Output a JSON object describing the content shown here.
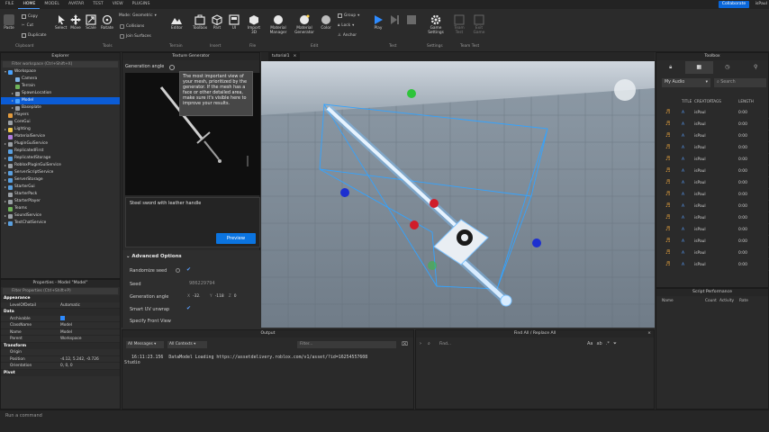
{
  "menubar": {
    "items": [
      "FILE",
      "HOME",
      "MODEL",
      "AVATAR",
      "TEST",
      "VIEW",
      "PLUGINS"
    ],
    "active": "HOME",
    "collaborate": "Collaborate",
    "user": "isPaul"
  },
  "ribbon": {
    "clipboard": {
      "paste": "Paste",
      "copy": "Copy",
      "cut": "Cut",
      "duplicate": "Duplicate",
      "group": "Clipboard"
    },
    "tools": {
      "select": "Select",
      "move": "Move",
      "scale": "Scale",
      "rotate": "Rotate",
      "group": "Tools",
      "mode_label": "Mode:",
      "mode_value": "Geometric",
      "collisions": "Collisions",
      "join_surfaces": "Join Surfaces"
    },
    "terrain": {
      "editor": "Editor",
      "group": "Terrain"
    },
    "insert": {
      "toolbox": "Toolbox",
      "part": "Part",
      "ui": "UI",
      "group": "Insert"
    },
    "file": {
      "import3d": "Import 3D",
      "group": "File"
    },
    "edit": {
      "material_manager": "Material Manager",
      "material_generator": "Material Generator",
      "color": "Color",
      "group_btn": "Group",
      "lock": "Lock",
      "anchor": "Anchor",
      "group": "Edit"
    },
    "test": {
      "play": "Play",
      "resume": "",
      "stop": "",
      "group": "Test"
    },
    "settings": {
      "game_settings": "Game Settings",
      "group": "Settings"
    },
    "team_test": {
      "team_test": "Team Test",
      "exit_game": "Exit Game",
      "group": "Team Test"
    }
  },
  "explorer": {
    "title": "Explorer",
    "filter_placeholder": "Filter workspace (Ctrl+Shift+X)",
    "items": [
      {
        "label": "Workspace",
        "indent": 0,
        "open": true,
        "color": "#4aa3ff"
      },
      {
        "label": "Camera",
        "indent": 1,
        "color": "#7fb2e5"
      },
      {
        "label": "Terrain",
        "indent": 1,
        "color": "#6fb35a"
      },
      {
        "label": "SpawnLocation",
        "indent": 1,
        "color": "#9aa0a6",
        "tw": true
      },
      {
        "label": "Model",
        "indent": 1,
        "color": "#4aa3ff",
        "sel": true,
        "tw": true
      },
      {
        "label": "Baseplate",
        "indent": 1,
        "color": "#9aa0a6",
        "tw": true
      },
      {
        "label": "Players",
        "indent": 0,
        "color": "#e39b3d"
      },
      {
        "label": "CoreGui",
        "indent": 0,
        "color": "#9aa0a6"
      },
      {
        "label": "Lighting",
        "indent": 0,
        "color": "#f0c84a",
        "tw": true
      },
      {
        "label": "MaterialService",
        "indent": 0,
        "color": "#b07de0"
      },
      {
        "label": "PluginGuiService",
        "indent": 0,
        "color": "#9aa0a6",
        "tw": true
      },
      {
        "label": "ReplicatedFirst",
        "indent": 0,
        "color": "#5aa0e0"
      },
      {
        "label": "ReplicatedStorage",
        "indent": 0,
        "color": "#5aa0e0",
        "tw": true
      },
      {
        "label": "RobloxPluginGuiService",
        "indent": 0,
        "color": "#9aa0a6",
        "tw": true
      },
      {
        "label": "ServerScriptService",
        "indent": 0,
        "color": "#5aa0e0",
        "tw": true
      },
      {
        "label": "ServerStorage",
        "indent": 0,
        "color": "#5aa0e0",
        "tw": true
      },
      {
        "label": "StarterGui",
        "indent": 0,
        "color": "#5aa0e0",
        "tw": true
      },
      {
        "label": "StarterPack",
        "indent": 0,
        "color": "#9aa0a6"
      },
      {
        "label": "StarterPlayer",
        "indent": 0,
        "color": "#9aa0a6",
        "tw": true
      },
      {
        "label": "Teams",
        "indent": 0,
        "color": "#6fb35a"
      },
      {
        "label": "SoundService",
        "indent": 0,
        "color": "#9aa0a6",
        "tw": true
      },
      {
        "label": "TextChatService",
        "indent": 0,
        "color": "#5aa0e0",
        "tw": true
      }
    ]
  },
  "properties": {
    "title": "Properties - Model \"Model\"",
    "filter_placeholder": "Filter Properties (Ctrl+Shift+P)",
    "rows": [
      {
        "cat": "Appearance"
      },
      {
        "k": "LevelOfDetail",
        "v": "Automatic"
      },
      {
        "cat": "Data"
      },
      {
        "k": "Archivable",
        "v": "check"
      },
      {
        "k": "ClassName",
        "v": "Model"
      },
      {
        "k": "Name",
        "v": "Model"
      },
      {
        "k": "Parent",
        "v": "Workspace"
      },
      {
        "cat": "Transform"
      },
      {
        "k": "Origin",
        "v": ""
      },
      {
        "k": "Position",
        "v": "-4.12, 5.242, -0.726"
      },
      {
        "k": "Orientation",
        "v": "0, 0, 0"
      },
      {
        "cat": "Pivot"
      }
    ]
  },
  "texture_generator": {
    "title": "Texture Generator",
    "generation_angle_label": "Generation angle",
    "tooltip": "The most important view of your mesh, prioritized by the generator. If the mesh has a face or other detailed area, make sure it's visible here to improve your results.",
    "prompt": "Steel sword with leather handle",
    "preview_button": "Preview",
    "advanced_header": "Advanced Options",
    "randomize_seed": "Randomize seed",
    "seed_label": "Seed",
    "seed_value": "986229794",
    "angle_label": "Generation angle",
    "angle_x": "-32.",
    "angle_y": "-118",
    "angle_z": "0",
    "smart_uv": "Smart UV unwrap",
    "specify_front": "Specify Front View"
  },
  "viewport": {
    "tab": "tutorial1"
  },
  "output": {
    "title": "Output",
    "messages_filter": "All Messages",
    "contexts_filter": "All Contexts",
    "filter_placeholder": "Filter...",
    "log_time": "16:11:23.156",
    "log_text": "DataModel Loading https://assetdelivery.roblox.com/v1/asset/?id=16254557608",
    "log_source": "Studio"
  },
  "find_replace": {
    "title": "Find All / Replace All",
    "find_placeholder": "Find..."
  },
  "toolbox": {
    "title": "Toolbox",
    "category": "My Audio",
    "search_placeholder": "Search",
    "columns": [
      "TITLE",
      "CREATOR",
      "TAGS",
      "LENGTH"
    ],
    "rows": [
      {
        "title": "A",
        "creator": "isPaul",
        "length": "0:00"
      },
      {
        "title": "A",
        "creator": "isPaul",
        "length": "0:00"
      },
      {
        "title": "A",
        "creator": "isPaul",
        "length": "0:00"
      },
      {
        "title": "A",
        "creator": "isPaul",
        "length": "0:00"
      },
      {
        "title": "A",
        "creator": "isPaul",
        "length": "0:00"
      },
      {
        "title": "A",
        "creator": "isPaul",
        "length": "0:00"
      },
      {
        "title": "A",
        "creator": "isPaul",
        "length": "0:00"
      },
      {
        "title": "A",
        "creator": "isPaul",
        "length": "0:00"
      },
      {
        "title": "A",
        "creator": "isPaul",
        "length": "0:00"
      },
      {
        "title": "A",
        "creator": "isPaul",
        "length": "0:00"
      },
      {
        "title": "A",
        "creator": "isPaul",
        "length": "0:00"
      },
      {
        "title": "A",
        "creator": "isPaul",
        "length": "0:00"
      },
      {
        "title": "A",
        "creator": "isPaul",
        "length": "0:00"
      },
      {
        "title": "A",
        "creator": "isPaul",
        "length": "0:00"
      }
    ]
  },
  "script_performance": {
    "title": "Script Performance",
    "columns": [
      "Name",
      "Count",
      "Activity",
      "Rate"
    ]
  },
  "command_bar": {
    "placeholder": "Run a command"
  },
  "colors": {
    "accent": "#0b5cd6",
    "selection": "#0b5cd6",
    "ribbon_bg": "#2b2b2b",
    "panel_bg": "#2e2e2e"
  }
}
